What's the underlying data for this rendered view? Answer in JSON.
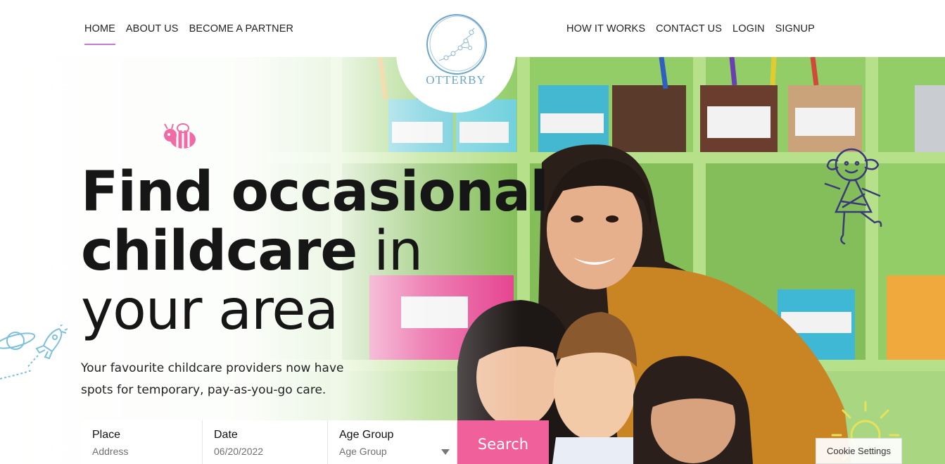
{
  "header": {
    "nav_left": [
      {
        "label": "HOME",
        "active": true
      },
      {
        "label": "ABOUT US"
      },
      {
        "label": "BECOME A PARTNER"
      }
    ],
    "nav_right": [
      {
        "label": "HOW IT WORKS"
      },
      {
        "label": "CONTACT US"
      },
      {
        "label": "LOGIN"
      },
      {
        "label": "SIGNUP"
      }
    ],
    "logo_text": "OTTERBY"
  },
  "hero": {
    "headline_bold_1": "Find occasional",
    "headline_bold_2": "childcare",
    "headline_light_2": " in",
    "headline_light_3": "your area",
    "subtitle": "Your favourite childcare providers now have spots for temporary, pay-as-you-go care."
  },
  "search": {
    "place_label": "Place",
    "place_value": "Address",
    "date_label": "Date",
    "date_value": "06/20/2022",
    "age_label": "Age Group",
    "age_value": "Age Group",
    "button_label": "Search"
  },
  "cookie_label": "Cookie Settings",
  "colors": {
    "accent_pink": "#f0609a",
    "nav_underline": "#c679d6",
    "logo_blue": "#6ea6c9",
    "shelf_green": "#8cc95f"
  },
  "icons": [
    "bee-icon",
    "girl-doodle-icon",
    "planet-icon",
    "rocket-icon",
    "sun-icon",
    "dropdown-caret-icon"
  ]
}
